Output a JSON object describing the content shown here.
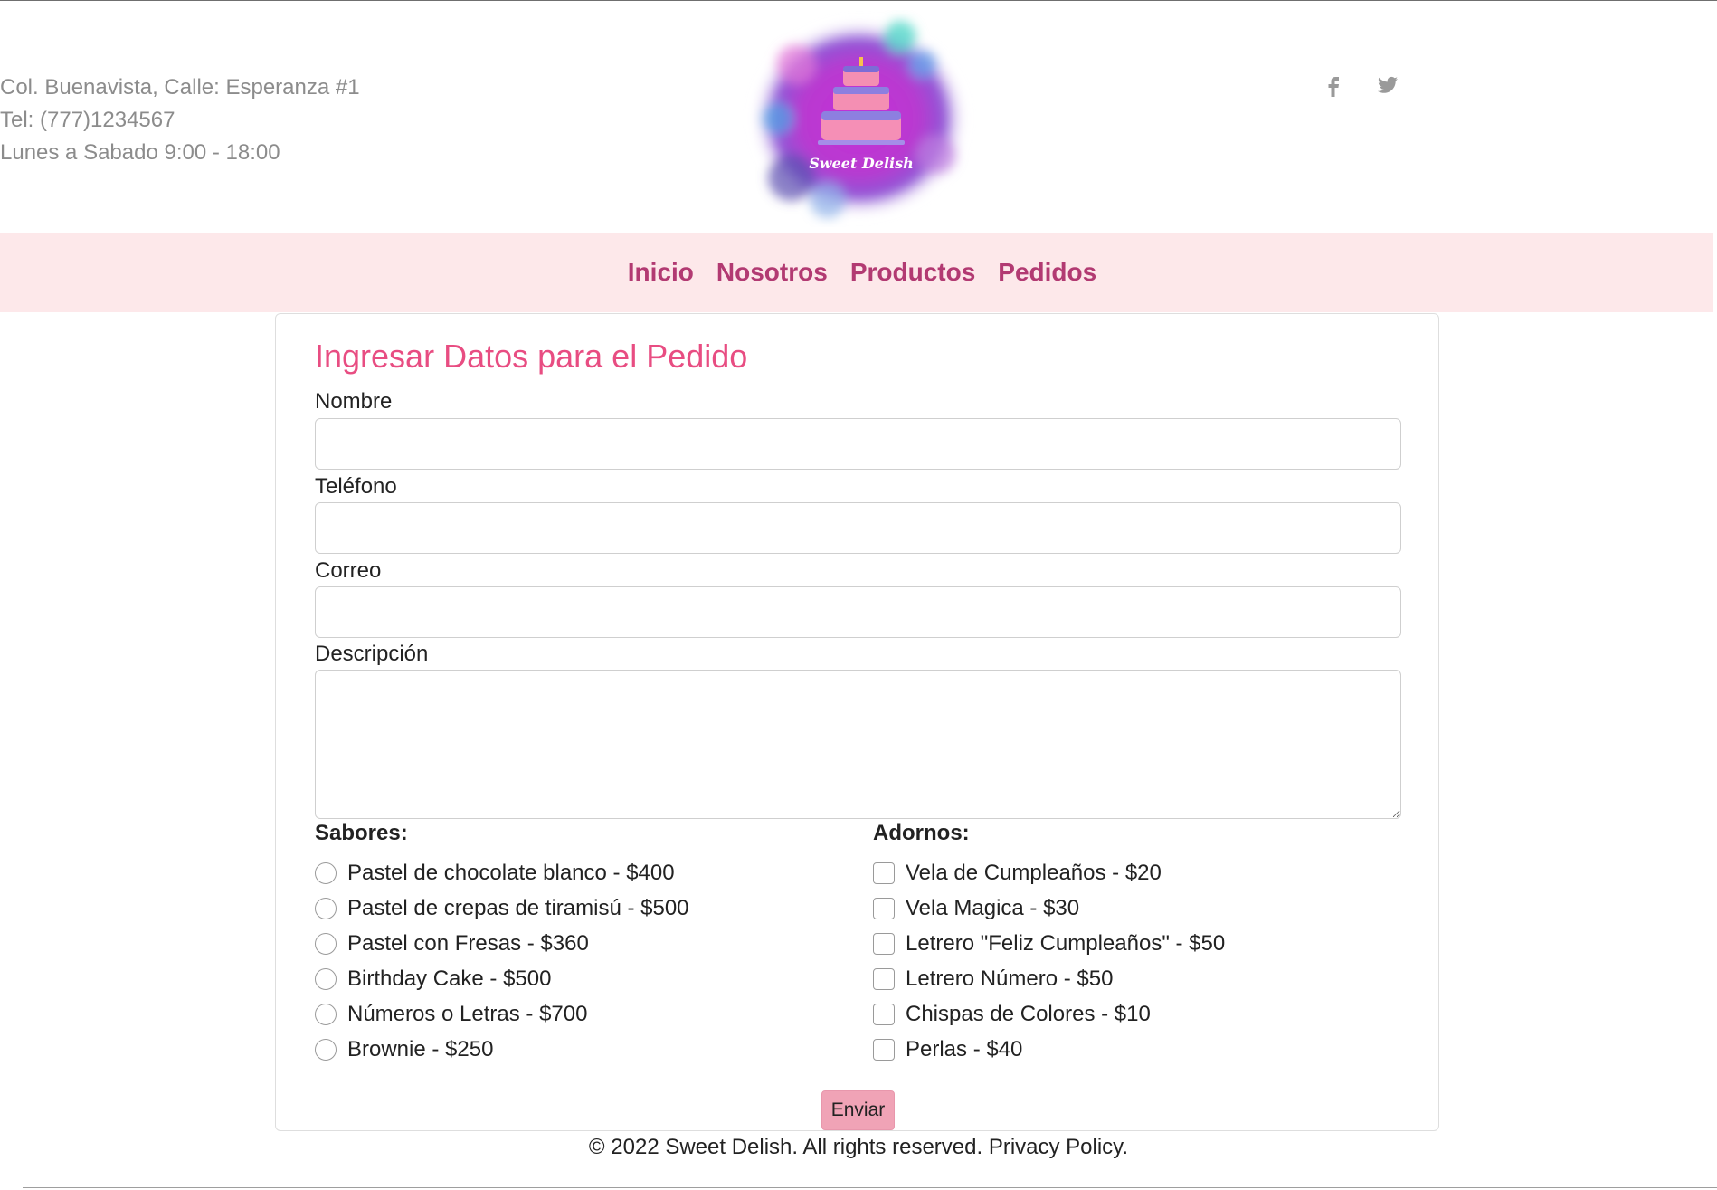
{
  "header": {
    "address": "Col. Buenavista, Calle: Esperanza #1",
    "phone": "Tel: (777)1234567",
    "hours": "Lunes a Sabado 9:00 - 18:00",
    "logo_text": "Sweet Delish",
    "social": [
      "facebook-icon",
      "twitter-icon"
    ]
  },
  "nav": {
    "items": [
      "Inicio",
      "Nosotros",
      "Productos",
      "Pedidos"
    ]
  },
  "form": {
    "title": "Ingresar Datos para el Pedido",
    "fields": {
      "nombre": {
        "label": "Nombre",
        "value": ""
      },
      "telefono": {
        "label": "Teléfono",
        "value": ""
      },
      "correo": {
        "label": "Correo",
        "value": ""
      },
      "descripcion": {
        "label": "Descripción",
        "value": ""
      }
    },
    "sabores": {
      "title": "Sabores:",
      "options": [
        "Pastel de chocolate blanco - $400",
        "Pastel de crepas de tiramisú - $500",
        "Pastel con Fresas - $360",
        "Birthday Cake - $500",
        "Números o Letras - $700",
        "Brownie - $250"
      ]
    },
    "adornos": {
      "title": "Adornos:",
      "options": [
        "Vela de Cumpleaños - $20",
        "Vela Magica - $30",
        "Letrero \"Feliz Cumpleaños\" - $50",
        "Letrero Número - $50",
        "Chispas de Colores - $10",
        "Perlas - $40"
      ]
    },
    "submit_label": "Enviar"
  },
  "footer": {
    "text": "©  2022 Sweet Delish.  All rights reserved. Privacy Policy."
  },
  "colors": {
    "nav_bg": "#fde8ea",
    "nav_link": "#b23a72",
    "title": "#e84d82",
    "button": "#f0a3b6"
  }
}
